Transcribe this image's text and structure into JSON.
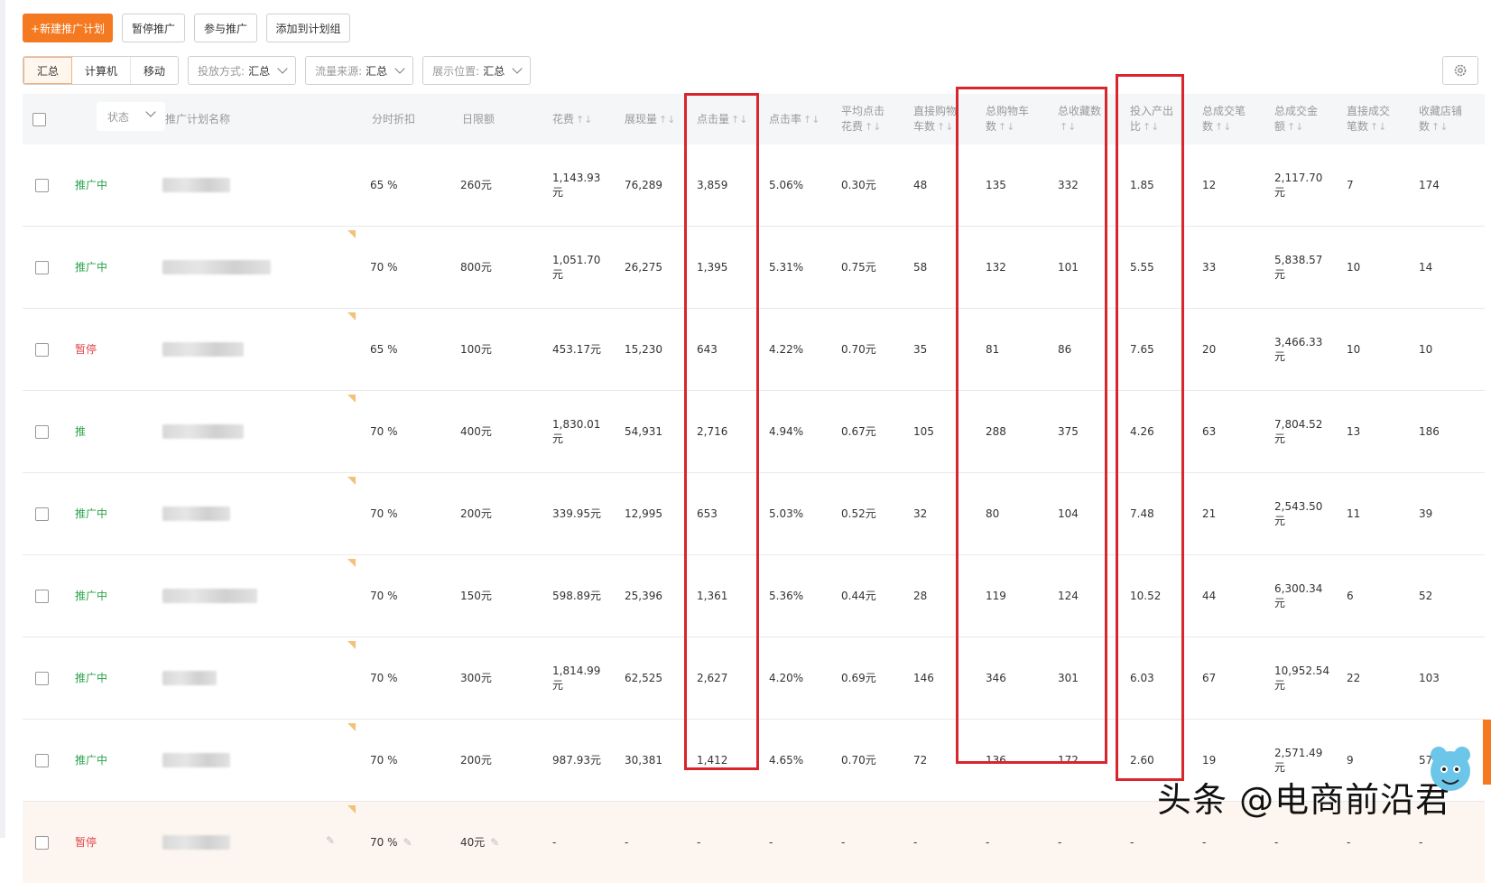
{
  "toolbar": {
    "new_plan": "+新建推广计划",
    "pause": "暂停推广",
    "join": "参与推广",
    "add_group": "添加到计划组"
  },
  "filters": {
    "tabs": [
      "汇总",
      "计算机",
      "移动"
    ],
    "delivery_label": "投放方式:",
    "delivery_value": "汇总",
    "traffic_label": "流量来源:",
    "traffic_value": "汇总",
    "position_label": "展示位置:",
    "position_value": "汇总"
  },
  "header": {
    "status": "状态",
    "name": "推广计划名称",
    "discount": "分时折扣",
    "budget": "日限额",
    "cost": "花费",
    "impressions": "展现量",
    "clicks": "点击量",
    "ctr": "点击率",
    "cpc_line1": "平均点击",
    "cpc_line2": "花费",
    "direct_cart_line1": "直接购物",
    "direct_cart_line2": "车数",
    "total_cart_line1": "总购物车",
    "total_cart_line2": "数",
    "total_fav_line1": "总收藏数",
    "total_fav_line2": "",
    "roi_line1": "投入产出",
    "roi_line2": "比",
    "total_orders_line1": "总成交笔",
    "total_orders_line2": "数",
    "total_amount_line1": "总成交金",
    "total_amount_line2": "额",
    "direct_orders_line1": "直接成交",
    "direct_orders_line2": "笔数",
    "shop_fav_line1": "收藏店铺",
    "shop_fav_line2": "数",
    "sort_glyph": "↑↓"
  },
  "rows": [
    {
      "status": "推广中",
      "status_type": "on",
      "discount": "65 %",
      "budget": "260元",
      "cost": "1,143.93",
      "cost_unit": "元",
      "impr": "76,289",
      "clicks": "3,859",
      "ctr": "5.06%",
      "cpc": "0.30元",
      "dcart": "48",
      "tcart": "135",
      "tfav": "332",
      "roi": "1.85",
      "torders": "12",
      "tamount": "2,117.70",
      "tamount_unit": "元",
      "dorders": "7",
      "sfav": "174"
    },
    {
      "status": "推广中",
      "status_type": "on",
      "discount": "70 %",
      "budget": "800元",
      "cost": "1,051.70",
      "cost_unit": "元",
      "impr": "26,275",
      "clicks": "1,395",
      "ctr": "5.31%",
      "cpc": "0.75元",
      "dcart": "58",
      "tcart": "132",
      "tfav": "101",
      "roi": "5.55",
      "torders": "33",
      "tamount": "5,838.57",
      "tamount_unit": "元",
      "dorders": "10",
      "sfav": "14"
    },
    {
      "status": "暂停",
      "status_type": "off",
      "discount": "65 %",
      "budget": "100元",
      "cost": "453.17元",
      "cost_unit": "",
      "impr": "15,230",
      "clicks": "643",
      "ctr": "4.22%",
      "cpc": "0.70元",
      "dcart": "35",
      "tcart": "81",
      "tfav": "86",
      "roi": "7.65",
      "torders": "20",
      "tamount": "3,466.33",
      "tamount_unit": "元",
      "dorders": "10",
      "sfav": "10"
    },
    {
      "status": "推",
      "status_type": "on",
      "discount": "70 %",
      "budget": "400元",
      "cost": "1,830.01",
      "cost_unit": "元",
      "impr": "54,931",
      "clicks": "2,716",
      "ctr": "4.94%",
      "cpc": "0.67元",
      "dcart": "105",
      "tcart": "288",
      "tfav": "375",
      "roi": "4.26",
      "torders": "63",
      "tamount": "7,804.52",
      "tamount_unit": "元",
      "dorders": "13",
      "sfav": "186"
    },
    {
      "status": "推广中",
      "status_type": "on",
      "discount": "70 %",
      "budget": "200元",
      "cost": "339.95元",
      "cost_unit": "",
      "impr": "12,995",
      "clicks": "653",
      "ctr": "5.03%",
      "cpc": "0.52元",
      "dcart": "32",
      "tcart": "80",
      "tfav": "104",
      "roi": "7.48",
      "torders": "21",
      "tamount": "2,543.50",
      "tamount_unit": "元",
      "dorders": "11",
      "sfav": "39"
    },
    {
      "status": "推广中",
      "status_type": "on",
      "discount": "70 %",
      "budget": "150元",
      "cost": "598.89元",
      "cost_unit": "",
      "impr": "25,396",
      "clicks": "1,361",
      "ctr": "5.36%",
      "cpc": "0.44元",
      "dcart": "28",
      "tcart": "119",
      "tfav": "124",
      "roi": "10.52",
      "torders": "44",
      "tamount": "6,300.34",
      "tamount_unit": "元",
      "dorders": "6",
      "sfav": "52"
    },
    {
      "status": "推广中",
      "status_type": "on",
      "discount": "70 %",
      "budget": "300元",
      "cost": "1,814.99",
      "cost_unit": "元",
      "impr": "62,525",
      "clicks": "2,627",
      "ctr": "4.20%",
      "cpc": "0.69元",
      "dcart": "146",
      "tcart": "346",
      "tfav": "301",
      "roi": "6.03",
      "torders": "67",
      "tamount": "10,952.54",
      "tamount_unit": "元",
      "dorders": "22",
      "sfav": "103"
    },
    {
      "status": "推广中",
      "status_type": "on",
      "discount": "70 %",
      "budget": "200元",
      "cost": "987.93元",
      "cost_unit": "",
      "impr": "30,381",
      "clicks": "1,412",
      "ctr": "4.65%",
      "cpc": "0.70元",
      "dcart": "72",
      "tcart": "136",
      "tfav": "172",
      "roi": "2.60",
      "torders": "19",
      "tamount": "2,571.49",
      "tamount_unit": "元",
      "dorders": "9",
      "sfav": "57"
    },
    {
      "status": "暂停",
      "status_type": "off",
      "discount": "70 %",
      "budget": "40元",
      "cost": "-",
      "cost_unit": "",
      "impr": "-",
      "clicks": "-",
      "ctr": "-",
      "cpc": "-",
      "dcart": "-",
      "tcart": "-",
      "tfav": "-",
      "roi": "-",
      "torders": "-",
      "tamount": "-",
      "tamount_unit": "",
      "dorders": "-",
      "sfav": "-"
    }
  ],
  "watermark": "头条 @电商前沿君",
  "colors": {
    "primary": "#f47920",
    "status_on": "#2aa54a",
    "status_off": "#e0484d",
    "highlight": "#d9262c"
  },
  "icons": {
    "settings": "gear-icon",
    "edit": "pencil-icon",
    "dropdown": "chevron-down-icon"
  }
}
